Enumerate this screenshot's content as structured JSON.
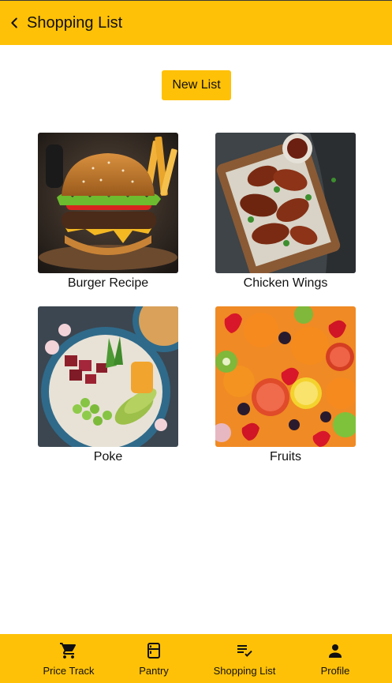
{
  "header": {
    "title": "Shopping List",
    "back_icon": "chevron-left-icon"
  },
  "actions": {
    "new_list_label": "New List"
  },
  "lists": [
    {
      "name": "Burger Recipe",
      "image": "burger-photo"
    },
    {
      "name": "Chicken Wings",
      "image": "chicken-wings-photo"
    },
    {
      "name": "Poke",
      "image": "poke-bowl-photo"
    },
    {
      "name": "Fruits",
      "image": "fruits-photo"
    }
  ],
  "bottom_nav": {
    "items": [
      {
        "label": "Price Track",
        "icon": "cart-icon"
      },
      {
        "label": "Pantry",
        "icon": "fridge-icon"
      },
      {
        "label": "Shopping List",
        "icon": "playlist-check-icon"
      },
      {
        "label": "Profile",
        "icon": "person-icon"
      }
    ]
  },
  "colors": {
    "accent": "#FFC107",
    "background": "#FFFFFF",
    "text": "#111111"
  }
}
